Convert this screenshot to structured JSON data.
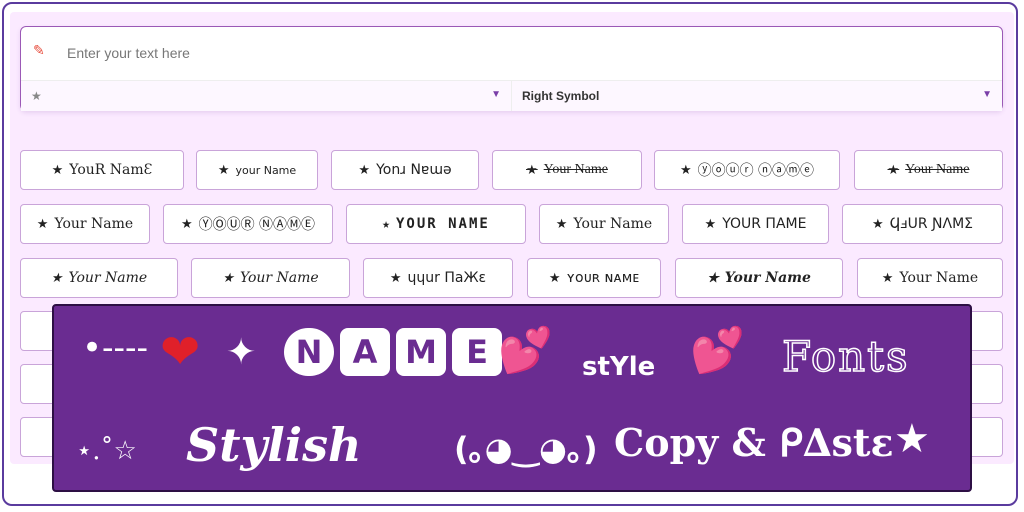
{
  "input": {
    "placeholder": "Enter your text here",
    "left_symbol_value": "★",
    "right_symbol_label": "Right Symbol"
  },
  "styles": {
    "row1": [
      "YouR NamƐ",
      "your Name",
      "Yonɹ Nɐɯǝ",
      "Your Name",
      "ⓨⓞⓤⓡ ⓝⓐⓜⓔ",
      "Your Name"
    ],
    "row2": [
      "Your Name",
      "ⓎⓄⓊⓇ ⓃⒶⓂⒺ",
      "YOUR NAME",
      "Your Name",
      "YOUR ПAME",
      "ϤⅎUR ƝΛMΣ"
    ],
    "row3": [
      "Your Name",
      "Your Name",
      "ɥɥur ΠaЖɛ",
      "ʏᴏᴜʀ ɴᴀᴍᴇ",
      "Your Name",
      "Your Name"
    ],
    "row1_label_prefix": "★"
  },
  "banner": {
    "dots": "•----",
    "heart": "❤",
    "sparkle": "✦",
    "name_letters": [
      "N",
      "A",
      "M",
      "E"
    ],
    "hearts": "💕",
    "style_word": "stYle",
    "fonts_word": "Fonts",
    "stars_left": "⋆.˚☆",
    "stylish_word": "Stylish",
    "face": "(｡◕‿◕｡)",
    "copy_paste": "Copy & ᑭ∆stɛ",
    "star_right": "★"
  }
}
